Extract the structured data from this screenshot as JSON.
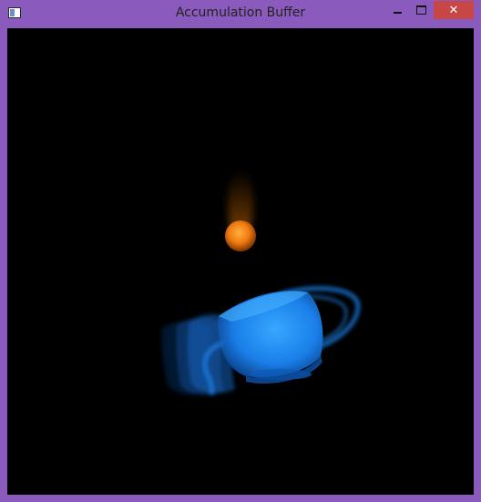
{
  "window": {
    "title": "Accumulation Buffer",
    "controls": {
      "minimize_icon": "minimize-icon",
      "maximize_icon": "maximize-icon",
      "close_glyph": "✕"
    }
  },
  "scene": {
    "background": "#000000",
    "sphere_color": "#f07a10",
    "teapot_color": "#1f8cff"
  }
}
